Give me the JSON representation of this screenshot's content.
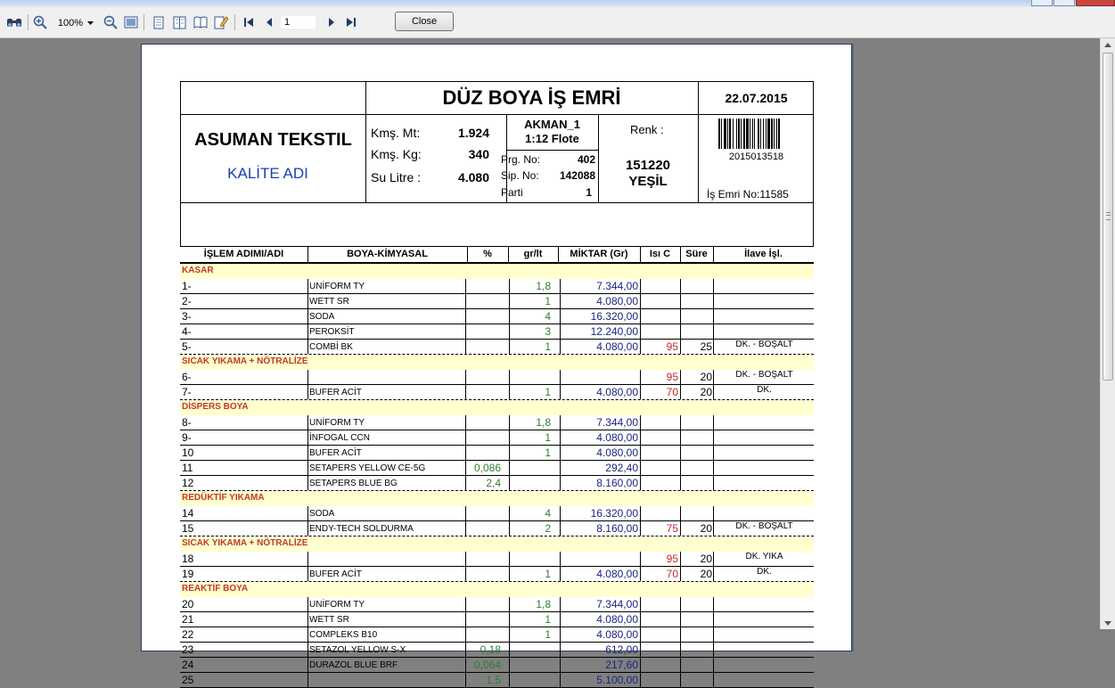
{
  "toolbar": {
    "zoom": "100%",
    "page": "1",
    "close_label": "Close"
  },
  "doc": {
    "title": "DÜZ BOYA İŞ EMRİ",
    "date": "22.07.2015",
    "company": "ASUMAN TEKSTIL",
    "quality": "KALİTE ADI",
    "kms_mt_label": "Kmş. Mt:",
    "kms_mt": "1.924",
    "kms_kg_label": "Kmş. Kg:",
    "kms_kg": "340",
    "su_label": "Su Litre :",
    "su": "4.080",
    "machine": "AKMAN_1",
    "flote": "1:12  Flote",
    "prg_label": "Prg. No:",
    "prg": "402",
    "sip_label": "Sip. No:",
    "sip": "142088",
    "parti_label": "Parti",
    "parti": "1",
    "renk_label": "Renk :",
    "renk_code": "151220",
    "renk_name": "YEŞİL",
    "barcode": "2015013518",
    "is_emri": "İş Emri No:11585"
  },
  "columns": [
    "İŞLEM ADIMI/ADI",
    "BOYA-KİMYASAL",
    "%",
    "gr/lt",
    "MİKTAR (Gr)",
    "Isı C",
    "Süre",
    "İlave İşl."
  ],
  "rows": [
    {
      "section": "KASAR"
    },
    {
      "step": "1-",
      "chem": "UNİFORM TY",
      "pct": "",
      "grlt": "1,8",
      "mik": "7.344,00",
      "isi": "",
      "sure": "",
      "ilave": ""
    },
    {
      "step": "2-",
      "chem": "WETT SR",
      "pct": "",
      "grlt": "1",
      "mik": "4.080,00",
      "isi": "",
      "sure": "",
      "ilave": ""
    },
    {
      "step": "3-",
      "chem": "SODA",
      "pct": "",
      "grlt": "4",
      "mik": "16.320,00",
      "isi": "",
      "sure": "",
      "ilave": ""
    },
    {
      "step": "4-",
      "chem": "PEROKSİT",
      "pct": "",
      "grlt": "3",
      "mik": "12.240,00",
      "isi": "",
      "sure": "",
      "ilave": ""
    },
    {
      "step": "5-",
      "chem": "COMBİ BK",
      "pct": "",
      "grlt": "1",
      "mik": "4.080,00",
      "isi": "95",
      "sure": "25",
      "ilave": "DK. - BOŞALT",
      "dash": true
    },
    {
      "section": "SICAK YIKAMA + NÖTRALİZE"
    },
    {
      "step": "6-",
      "chem": "",
      "pct": "",
      "grlt": "",
      "mik": "",
      "isi": "95",
      "sure": "20",
      "ilave": "DK. - BOŞALT"
    },
    {
      "step": "7-",
      "chem": "BUFER ACİT",
      "pct": "",
      "grlt": "1",
      "mik": "4.080,00",
      "isi": "70",
      "sure": "20",
      "ilave": "DK.",
      "dash": true
    },
    {
      "section": "DİSPERS BOYA"
    },
    {
      "step": "8-",
      "chem": "UNİFORM TY",
      "pct": "",
      "grlt": "1,8",
      "mik": "7.344,00",
      "isi": "",
      "sure": "",
      "ilave": ""
    },
    {
      "step": "9-",
      "chem": "İNFOGAL CCN",
      "pct": "",
      "grlt": "1",
      "mik": "4.080,00",
      "isi": "",
      "sure": "",
      "ilave": ""
    },
    {
      "step": "10",
      "chem": "BUFER ACİT",
      "pct": "",
      "grlt": "1",
      "mik": "4.080,00",
      "isi": "",
      "sure": "",
      "ilave": ""
    },
    {
      "step": "11",
      "chem": "SETAPERS YELLOW CE-5G",
      "pct": "0,086",
      "grlt": "",
      "mik": "292,40",
      "isi": "",
      "sure": "",
      "ilave": ""
    },
    {
      "step": "12",
      "chem": "SETAPERS BLUE BG",
      "pct": "2,4",
      "grlt": "",
      "mik": "8.160,00",
      "isi": "",
      "sure": "",
      "ilave": "",
      "dash": true
    },
    {
      "section": "REDÜKTİF YIKAMA"
    },
    {
      "step": "14",
      "chem": "SODA",
      "pct": "",
      "grlt": "4",
      "mik": "16.320,00",
      "isi": "",
      "sure": "",
      "ilave": ""
    },
    {
      "step": "15",
      "chem": "ENDY-TECH SOLDURMA",
      "pct": "",
      "grlt": "2",
      "mik": "8.160,00",
      "isi": "75",
      "sure": "20",
      "ilave": "DK. - BOŞALT",
      "dash": true
    },
    {
      "section": "SICAK YIKAMA + NÖTRALİZE"
    },
    {
      "step": "18",
      "chem": "",
      "pct": "",
      "grlt": "",
      "mik": "",
      "isi": "95",
      "sure": "20",
      "ilave": "DK. YIKA"
    },
    {
      "step": "19",
      "chem": "BUFER ACİT",
      "pct": "",
      "grlt": "1",
      "mik": "4.080,00",
      "isi": "70",
      "sure": "20",
      "ilave": "DK.",
      "dash": true
    },
    {
      "section": "REAKTİF BOYA"
    },
    {
      "step": "20",
      "chem": "UNİFORM TY",
      "pct": "",
      "grlt": "1,8",
      "mik": "7.344,00",
      "isi": "",
      "sure": "",
      "ilave": ""
    },
    {
      "step": "21",
      "chem": "WETT SR",
      "pct": "",
      "grlt": "1",
      "mik": "4.080,00",
      "isi": "",
      "sure": "",
      "ilave": ""
    },
    {
      "step": "22",
      "chem": "COMPLEKS B10",
      "pct": "",
      "grlt": "1",
      "mik": "4.080,00",
      "isi": "",
      "sure": "",
      "ilave": ""
    },
    {
      "step": "23",
      "chem": "SETAZOL YELLOW S-X",
      "pct": "0,18",
      "grlt": "",
      "mik": "612,00",
      "isi": "",
      "sure": "",
      "ilave": ""
    },
    {
      "step": "24",
      "chem": "DURAZOL BLUE BRF",
      "pct": "0,064",
      "grlt": "",
      "mik": "217,60",
      "isi": "",
      "sure": "",
      "ilave": ""
    },
    {
      "step": "25",
      "chem": "",
      "pct": "1,5",
      "grlt": "",
      "mik": "5.100,00",
      "isi": "",
      "sure": "",
      "ilave": ""
    }
  ]
}
